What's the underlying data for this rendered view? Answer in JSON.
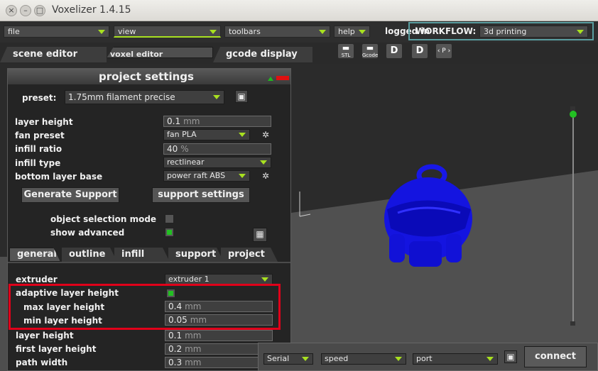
{
  "window": {
    "title": "Voxelizer 1.4.15"
  },
  "menu": {
    "file": "file",
    "view": "view",
    "toolbars": "toolbars",
    "help": "help"
  },
  "user": {
    "logged": "logged in",
    "workflow_label": "WORKFLOW:",
    "workflow_value": "3d printing"
  },
  "tabs": {
    "scene": "scene editor",
    "voxel": "voxel editor",
    "gcode": "gcode display"
  },
  "toolbar_icons": [
    "STL",
    "Gcode",
    "D",
    "D",
    "P"
  ],
  "panel": {
    "title": "project settings",
    "preset_label": "preset:",
    "preset_value": "1.75mm filament precise",
    "rows": {
      "layer_height": {
        "label": "layer height",
        "value": "0.1",
        "unit": "mm"
      },
      "fan_preset": {
        "label": "fan preset",
        "value": "fan PLA"
      },
      "infill_ratio": {
        "label": "infill ratio",
        "value": "40",
        "unit": "%"
      },
      "infill_type": {
        "label": "infill type",
        "value": "rectlinear"
      },
      "bottom_layer": {
        "label": "bottom layer base",
        "value": "power raft ABS"
      }
    },
    "gen_support": "Generate Support",
    "support_settings": "support settings",
    "object_selection": {
      "label": "object selection mode",
      "checked": false
    },
    "show_advanced": {
      "label": "show advanced",
      "checked": true
    },
    "subtabs": [
      "general",
      "outline",
      "infill",
      "support",
      "project"
    ],
    "extruder": {
      "label": "extruder",
      "value": "extruder 1"
    },
    "adaptive": {
      "label": "adaptive layer height",
      "checked": true
    },
    "max_layer": {
      "label": "max layer height",
      "value": "0.4",
      "unit": "mm"
    },
    "min_layer": {
      "label": "min layer height",
      "value": "0.05",
      "unit": "mm"
    },
    "layer_height2": {
      "label": "layer height",
      "value": "0.1",
      "unit": "mm"
    },
    "first_layer": {
      "label": "first layer height",
      "value": "0.2",
      "unit": "mm"
    },
    "path_width": {
      "label": "path width",
      "value": "0.3",
      "unit": "mm"
    }
  },
  "bottom": {
    "serial": "Serial",
    "speed": "speed",
    "port": "port",
    "connect": "connect"
  },
  "colors": {
    "accent_green": "#a8e020",
    "highlight_red": "#e0001a",
    "model_blue": "#1010e0"
  }
}
